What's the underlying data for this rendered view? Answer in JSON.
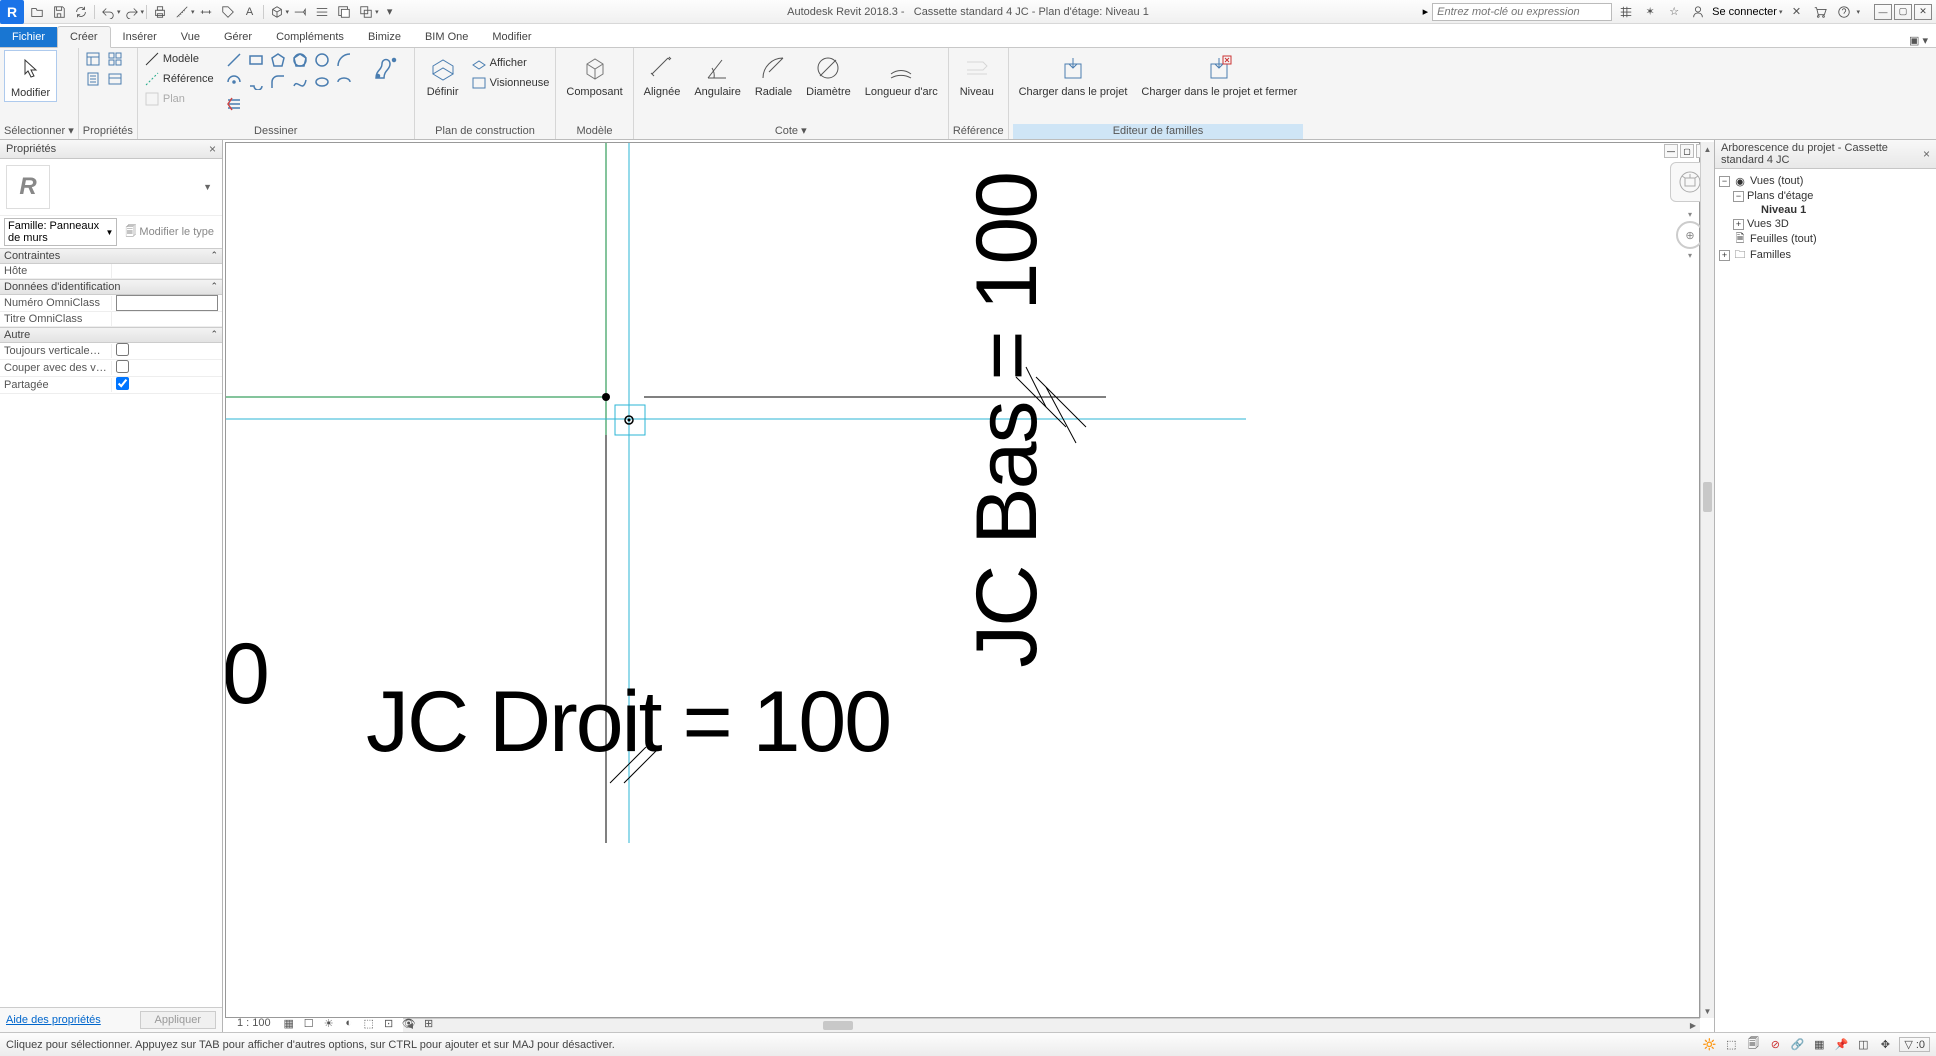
{
  "titlebar": {
    "app": "Autodesk Revit 2018.3 -",
    "doc": "Cassette standard 4 JC - Plan d'étage: Niveau 1",
    "search_placeholder": "Entrez mot-clé ou expression",
    "signin": "Se connecter",
    "info_arrow": "▸"
  },
  "tabs": {
    "file": "Fichier",
    "create": "Créer",
    "insert": "Insérer",
    "view": "Vue",
    "manage": "Gérer",
    "addins": "Compléments",
    "bimize": "Bimize",
    "bimone": "BIM One",
    "modify": "Modifier"
  },
  "ribbon": {
    "select": {
      "modify": "Modifier",
      "panel": "Sélectionner ▾"
    },
    "props": {
      "panel": "Propriétés"
    },
    "draw": {
      "model": "Modèle",
      "reference": "Référence",
      "plan": "Plan",
      "panel": "Dessiner"
    },
    "workplane": {
      "define": "Définir",
      "show": "Afficher",
      "viewer": "Visionneuse",
      "panel": "Plan de construction"
    },
    "model": {
      "component": "Composant",
      "panel": "Modèle"
    },
    "dim": {
      "aligned": "Alignée",
      "angular": "Angulaire",
      "radial": "Radiale",
      "diameter": "Diamètre",
      "arclen": "Longueur d'arc",
      "panel": "Cote  ▾"
    },
    "ref": {
      "level": "Niveau",
      "panel": "Référence"
    },
    "family": {
      "load": "Charger dans le projet",
      "loadclose": "Charger dans le projet et fermer",
      "panel": "Editeur de familles"
    }
  },
  "properties": {
    "title": "Propriétés",
    "type_logo": "R",
    "family_label": "Famille: Panneaux de murs",
    "edit_type": "Modifier le type",
    "groups": {
      "constraints": "Contraintes",
      "host": "Hôte",
      "identity": "Données d'identification",
      "omninum": "Numéro OmniClass",
      "omnititle": "Titre OmniClass",
      "other": "Autre",
      "always_vertical": "Toujours verticalement",
      "cut_voids": "Couper avec des vides ...",
      "shared": "Partagée"
    },
    "values": {
      "host": "",
      "omninum": "",
      "omnititle": "",
      "always_vertical": false,
      "cut_voids": false,
      "shared": true
    },
    "help": "Aide des propriétés",
    "apply": "Appliquer"
  },
  "canvas": {
    "scale": "1 : 100",
    "dim_vert": "JC Bas = 100",
    "dim_horiz": "JC Droit = 100",
    "clip0": "0"
  },
  "browser": {
    "title": "Arborescence du projet - Cassette standard 4 JC",
    "views": "Vues (tout)",
    "plans": "Plans d'étage",
    "level1": "Niveau 1",
    "views3d": "Vues 3D",
    "sheets": "Feuilles (tout)",
    "families": "Familles"
  },
  "statusbar": {
    "hint": "Cliquez pour sélectionner. Appuyez sur TAB pour afficher d'autres options, sur CTRL pour ajouter et sur MAJ pour désactiver.",
    "filter_count": ":0"
  }
}
